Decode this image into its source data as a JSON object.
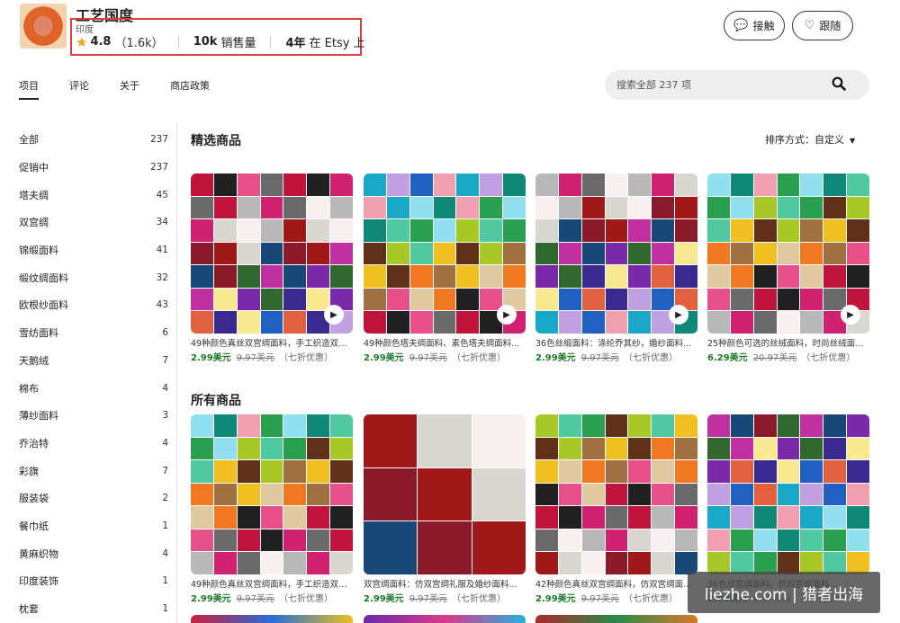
{
  "shop": {
    "name": "工艺国度",
    "country": "印度",
    "rating": "4.8",
    "rating_count": "（1.6k）",
    "sales_num": "10k",
    "sales_label": "销售量",
    "years_num": "4年",
    "years_label": "在 Etsy 上"
  },
  "buttons": {
    "contact": "接触",
    "follow": "跟随"
  },
  "tabs": [
    "项目",
    "评论",
    "关于",
    "商店政策"
  ],
  "search": {
    "placeholder": "搜索全部 237 项"
  },
  "sidebar": [
    {
      "label": "全部",
      "count": "237"
    },
    {
      "label": "促销中",
      "count": "237"
    },
    {
      "label": "塔夫绸",
      "count": "45"
    },
    {
      "label": "双宫绸",
      "count": "34"
    },
    {
      "label": "锦缎面料",
      "count": "41"
    },
    {
      "label": "缎纹绸面料",
      "count": "32"
    },
    {
      "label": "欧根纱面料",
      "count": "43"
    },
    {
      "label": "雪纺面料",
      "count": "6"
    },
    {
      "label": "天鹅绒",
      "count": "7"
    },
    {
      "label": "棉布",
      "count": "4"
    },
    {
      "label": "薄纱面料",
      "count": "3"
    },
    {
      "label": "乔治特",
      "count": "4"
    },
    {
      "label": "彩旗",
      "count": "7"
    },
    {
      "label": "服装袋",
      "count": "2"
    },
    {
      "label": "餐巾纸",
      "count": "1"
    },
    {
      "label": "黄麻织物",
      "count": "4"
    },
    {
      "label": "印度装饰",
      "count": "1"
    },
    {
      "label": "枕套",
      "count": "1"
    }
  ],
  "featured": {
    "title": "精选商品",
    "sort_label": "排序方式：",
    "sort_value": "自定义",
    "items": [
      {
        "title": "49种颜色真丝双宫绸面料，手工织造双宫...",
        "price": "2.99美元",
        "old_price": "9.97美元",
        "discount": "（七折优惠）"
      },
      {
        "title": "49种颜色塔夫绸面料、素色塔夫绸面料...",
        "price": "2.99美元",
        "old_price": "9.97美元",
        "discount": "（七折优惠）"
      },
      {
        "title": "36色丝缎面料：涤纶乔其纱，婚纱面料...",
        "price": "2.99美元",
        "old_price": "9.97美元",
        "discount": "（七折优惠）"
      },
      {
        "title": "25种颜色可选的丝绒面料，时尚丝绒面料...",
        "price": "6.29美元",
        "old_price": "20.97美元",
        "discount": "（七折优惠）"
      }
    ]
  },
  "all": {
    "title": "所有商品",
    "items": [
      {
        "title": "49种颜色真丝双宫绸面料，手工织造双宫...",
        "price": "2.99美元",
        "old_price": "9.97美元",
        "discount": "（七折优惠）"
      },
      {
        "title": "双宫绸面料：仿双宫绸礼服及婚纱面料...",
        "price": "2.99美元",
        "old_price": "9.97美元",
        "discount": "（七折优惠）"
      },
      {
        "title": "42种颜色真丝双宫绸面料，仿双宫绸面料...",
        "price": "2.99美元",
        "old_price": "9.97美元",
        "discount": "（七折优惠）"
      },
      {
        "title": "36色双宫绸面料，仿双宫绸面料...",
        "price": "2.99美元",
        "old_price": "9.97美元",
        "discount": "（七折优惠）"
      }
    ]
  },
  "watermark": "liezhe.com | 猎者出海",
  "colors": {
    "accent_border": "#e23b3b",
    "price_green": "#1f7a2c",
    "star": "#f1a10d"
  },
  "icons": {
    "contact": "chat-bubble-icon",
    "follow": "heart-icon",
    "search": "search-icon",
    "star": "star-icon",
    "play": "play-icon",
    "sort": "caret-down-icon"
  }
}
